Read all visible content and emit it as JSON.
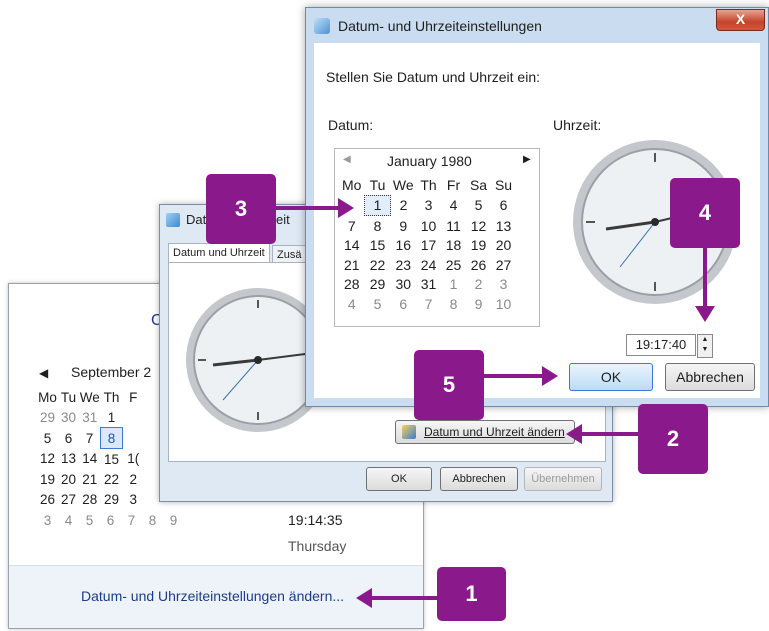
{
  "flyout": {
    "header_partial": "C",
    "month_label": "September 2",
    "weekdays": [
      "Mo",
      "Tu",
      "We",
      "Th",
      "F"
    ],
    "rows": [
      [
        "29",
        "30",
        "31",
        "1",
        ""
      ],
      [
        "5",
        "6",
        "7",
        "8",
        ""
      ],
      [
        "12",
        "13",
        "14",
        "15",
        "1("
      ],
      [
        "19",
        "20",
        "21",
        "22",
        "2"
      ],
      [
        "26",
        "27",
        "28",
        "29",
        "3"
      ],
      [
        "3",
        "4",
        "5",
        "6",
        "7",
        "8",
        "9"
      ]
    ],
    "time": "19:14:35",
    "weekday_name": "Thursday",
    "change_link": "Datum- und Uhrzeiteinstellungen ändern..."
  },
  "dialog2": {
    "title_a": "Datu",
    "title_b": "eit",
    "tab_active": "Datum und Uhrzeit",
    "tab_other": "Zusä",
    "change_button": "Datum und Uhrzeit ändern",
    "ok": "OK",
    "cancel": "Abbrechen",
    "apply": "Übernehmen"
  },
  "dialog3": {
    "title": "Datum- und Uhrzeiteinstellungen",
    "close_glyph": "X",
    "prompt": "Stellen Sie Datum und Uhrzeit ein:",
    "date_label": "Datum:",
    "time_label": "Uhrzeit:",
    "month": "January 1980",
    "weekdays": [
      "Mo",
      "Tu",
      "We",
      "Th",
      "Fr",
      "Sa",
      "Su"
    ],
    "rows": [
      [
        "",
        "1",
        "2",
        "3",
        "4",
        "5",
        "6"
      ],
      [
        "7",
        "8",
        "9",
        "10",
        "11",
        "12",
        "13"
      ],
      [
        "14",
        "15",
        "16",
        "17",
        "18",
        "19",
        "20"
      ],
      [
        "21",
        "22",
        "23",
        "24",
        "25",
        "26",
        "27"
      ],
      [
        "28",
        "29",
        "30",
        "31",
        "1",
        "2",
        "3"
      ],
      [
        "4",
        "5",
        "6",
        "7",
        "8",
        "9",
        "10"
      ]
    ],
    "time_value": "19:17:40",
    "ok": "OK",
    "cancel": "Abbrechen"
  },
  "callouts": [
    "1",
    "2",
    "3",
    "4",
    "5"
  ],
  "colors": {
    "callout": "#8a1a8c",
    "link": "#1a3c8c",
    "selected": "#3a7bd5"
  }
}
